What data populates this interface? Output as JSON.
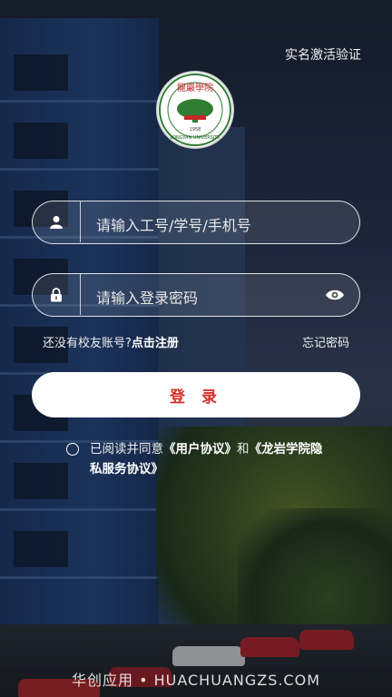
{
  "header": {
    "verify_link": "实名激活验证"
  },
  "logo": {
    "name": "Longyan University seal"
  },
  "login_form": {
    "account_placeholder": "请输入工号/学号/手机号",
    "password_placeholder": "请输入登录密码",
    "no_account_text": "还没有校友账号?",
    "register_link": "点击注册",
    "forgot_password": "忘记密码",
    "login_button": "登 录"
  },
  "agreement": {
    "prefix": "已阅读并同意",
    "user_agreement": "《用户协议》",
    "conj": "和",
    "privacy_policy": "《龙岩学院隐私服务协议》"
  },
  "watermark": "华创应用 • HUACHUANGZS.COM",
  "colors": {
    "accent": "#d4312b",
    "button_bg": "#ffffff"
  }
}
